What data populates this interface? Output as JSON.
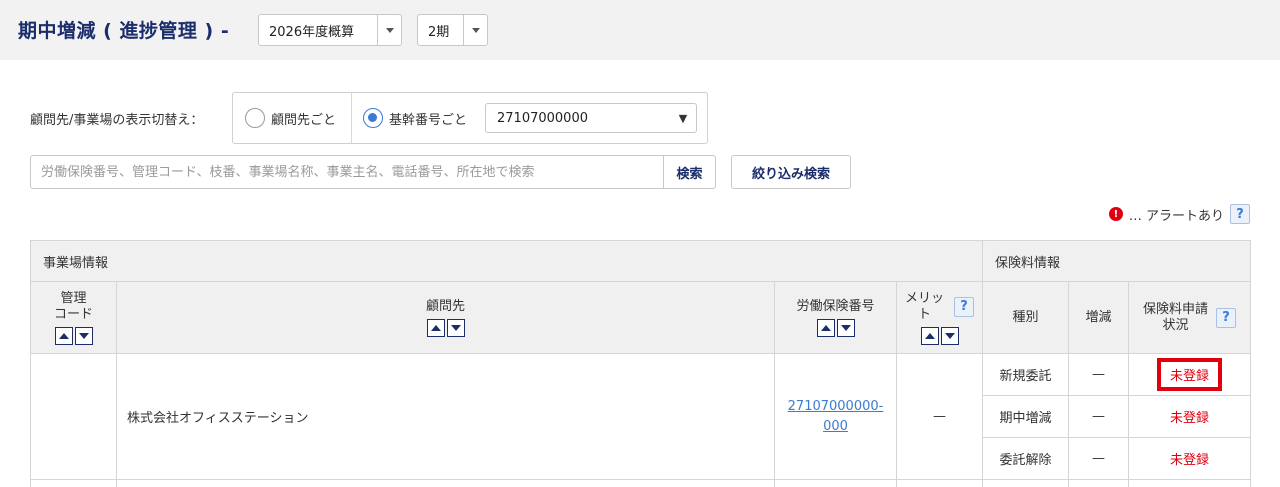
{
  "header": {
    "title": "期中増減 ( 進捗管理 ) -",
    "year_select": "2026年度概算",
    "period_select": "2期"
  },
  "display_switch": {
    "label": "顧問先/事業場の表示切替え：",
    "option_client": "顧問先ごと",
    "option_base_number": "基幹番号ごと",
    "selected_option": "基幹番号ごと",
    "base_number_value": "27107000000"
  },
  "search": {
    "placeholder": "労働保険番号、管理コード、枝番、事業場名称、事業主名、電話番号、所在地で検索",
    "value": "",
    "search_button": "検索",
    "filter_button": "絞り込み検索"
  },
  "alert_legend": {
    "icon": "!",
    "text": "… アラートあり",
    "help": "?"
  },
  "table": {
    "group_headers": {
      "office_info": "事業場情報",
      "premium_info": "保険料情報"
    },
    "columns": {
      "mgmt_code_line1": "管理",
      "mgmt_code_line2": "コード",
      "client": "顧問先",
      "labor_ins_no": "労働保険番号",
      "merit_line1": "メリッ",
      "merit_line2": "ト",
      "type": "種別",
      "change": "増減",
      "status_line1": "保険料申請",
      "status_line2": "状況",
      "help": "?"
    },
    "rows": [
      {
        "mgmt_code": "",
        "client": "株式会社オフィスステーション",
        "labor_ins_no_line1": "27107000000-",
        "labor_ins_no_line2": "000",
        "merit": "—",
        "sub_rows": [
          {
            "type": "新規委託",
            "change": "—",
            "status": "未登録",
            "highlighted": true
          },
          {
            "type": "期中増減",
            "change": "—",
            "status": "未登録",
            "highlighted": false
          },
          {
            "type": "委託解除",
            "change": "—",
            "status": "未登録",
            "highlighted": false
          }
        ]
      }
    ]
  },
  "colors": {
    "accent_navy": "#1b2d6b",
    "link_blue": "#3a7bd5",
    "alert_red": "#e00010",
    "header_bg": "#f2f2f2"
  }
}
